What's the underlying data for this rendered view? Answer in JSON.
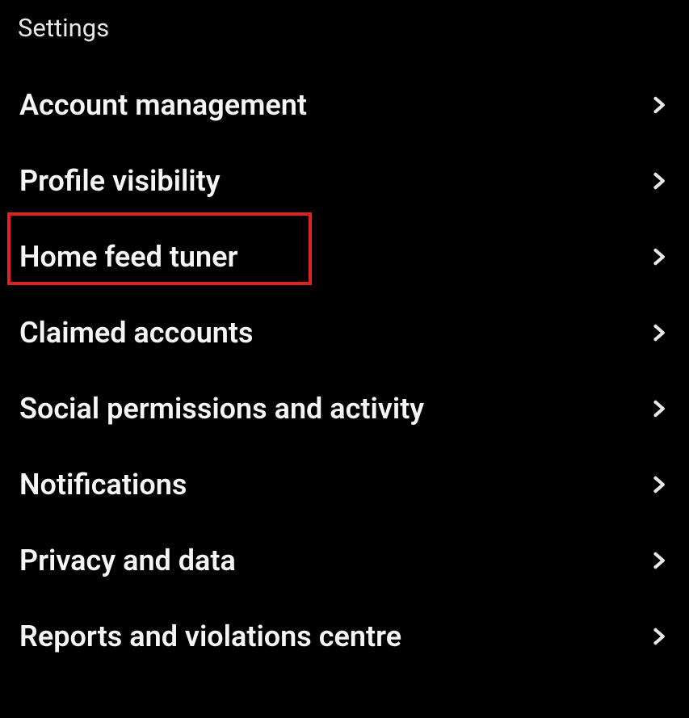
{
  "header": {
    "title": "Settings"
  },
  "items": [
    {
      "label": "Account management"
    },
    {
      "label": "Profile visibility"
    },
    {
      "label": "Home feed tuner"
    },
    {
      "label": "Claimed accounts"
    },
    {
      "label": "Social permissions and activity"
    },
    {
      "label": "Notifications"
    },
    {
      "label": "Privacy and data"
    },
    {
      "label": "Reports and violations centre"
    }
  ]
}
